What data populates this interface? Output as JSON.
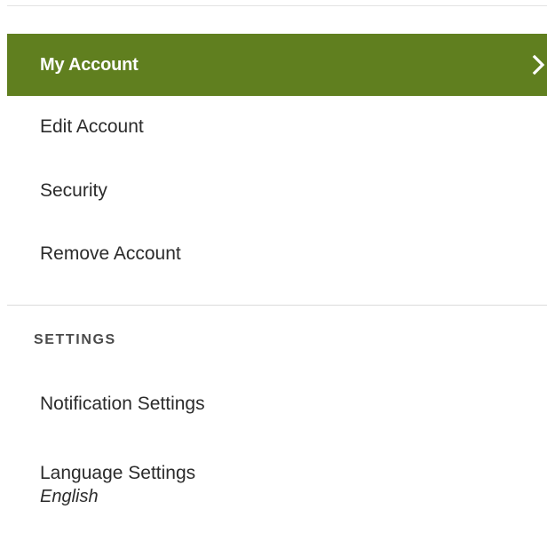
{
  "account_menu": {
    "items": [
      {
        "label": "My Account",
        "active": true
      },
      {
        "label": "Edit Account"
      },
      {
        "label": "Security"
      },
      {
        "label": "Remove Account"
      }
    ]
  },
  "settings_section": {
    "heading": "SETTINGS",
    "items": [
      {
        "label": "Notification Settings"
      },
      {
        "label": "Language Settings",
        "sub": "English"
      }
    ]
  },
  "colors": {
    "active_bg": "#607f1f",
    "active_text": "#ffffff",
    "text": "#2b2b2b",
    "divider": "#dcdcdc"
  },
  "icons": {
    "active_item": "chevron-right-icon"
  }
}
